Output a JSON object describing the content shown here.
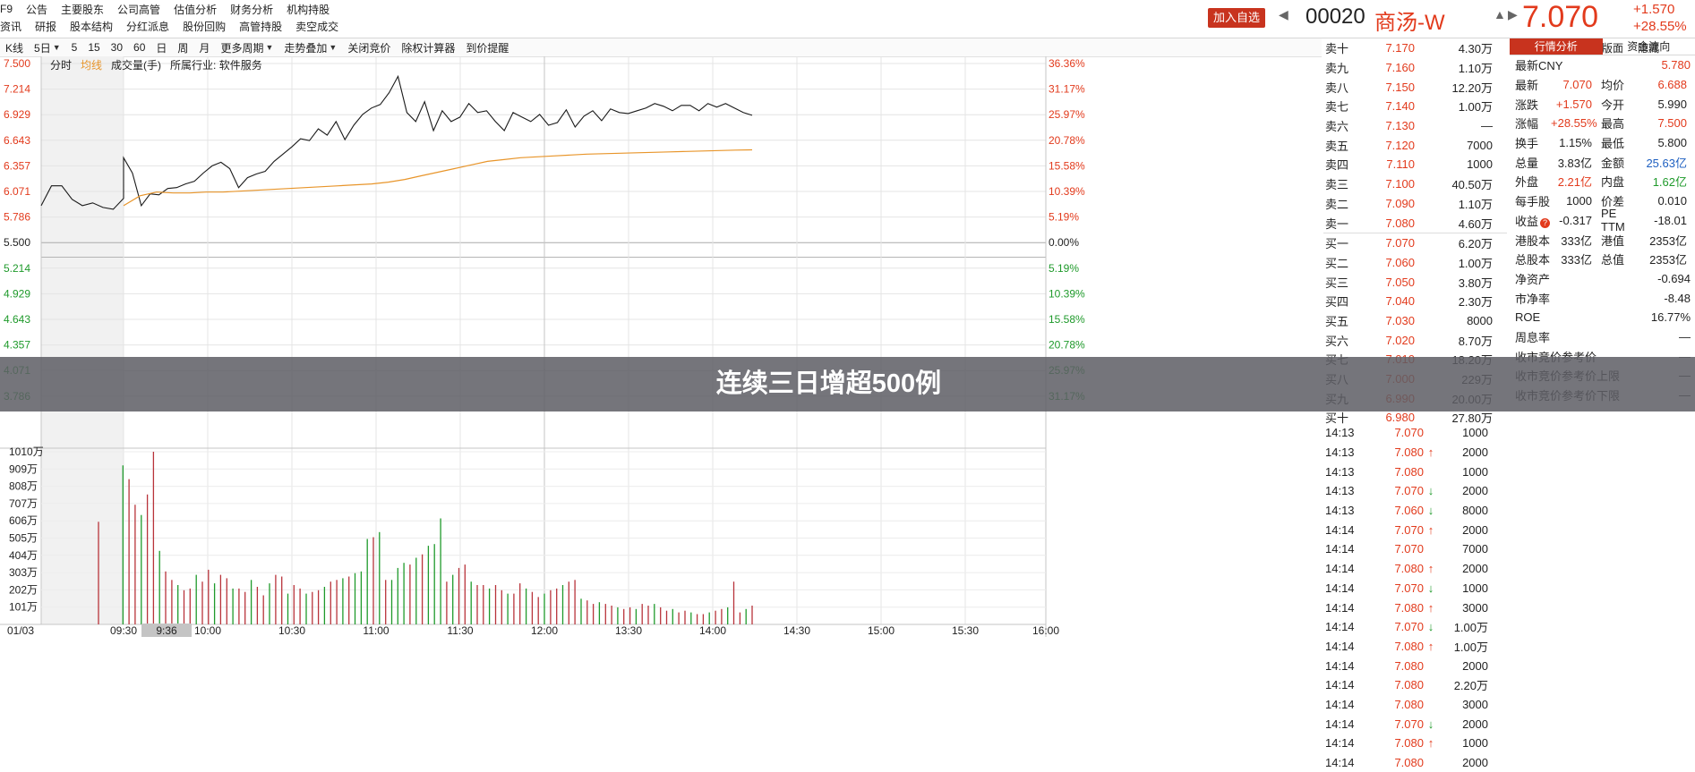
{
  "menu": {
    "row1": [
      "F9",
      "公告",
      "主要股东",
      "公司高管",
      "估值分析",
      "财务分析",
      "机构持股"
    ],
    "row2": [
      "资讯",
      "研报",
      "股本结构",
      "分红派息",
      "股份回购",
      "高管持股",
      "卖空成交"
    ]
  },
  "header": {
    "add_watch": "加入自选",
    "code": "00020",
    "name": "商汤-W",
    "price": "7.070",
    "change": "+1.570",
    "change_pct": "+28.55%"
  },
  "toolbar": {
    "items": [
      "K线",
      "5日",
      "5",
      "15",
      "30",
      "60",
      "日",
      "周",
      "月",
      "更多周期",
      "走势叠加",
      "关闭竞价",
      "除权计算器",
      "到价提醒"
    ],
    "right": [
      "简约版面",
      "隐藏"
    ]
  },
  "subbar": {
    "items": [
      "分时",
      "均线",
      "成交量(手)",
      "所属行业: 软件服务"
    ]
  },
  "chart_data": {
    "type": "line",
    "date_label": "01/03",
    "time_labels": [
      "09:30",
      "10:00",
      "10:30",
      "11:00",
      "11:30",
      "12:00",
      "13:30",
      "14:00",
      "14:30",
      "15:00",
      "15:30",
      "16:00"
    ],
    "cursor_time": "9:36",
    "price_ticks": [
      "7.500",
      "7.214",
      "6.929",
      "6.643",
      "6.357",
      "6.071",
      "5.786",
      "5.500",
      "5.214",
      "4.929",
      "4.643",
      "4.357",
      "4.071",
      "3.786"
    ],
    "pct_ticks": [
      "36.36%",
      "31.17%",
      "25.97%",
      "20.78%",
      "15.58%",
      "10.39%",
      "5.19%",
      "0.00%",
      "5.19%",
      "10.39%",
      "15.58%",
      "20.78%",
      "25.97%",
      "31.17%"
    ],
    "vol_ticks": [
      "1010万",
      "909万",
      "808万",
      "707万",
      "606万",
      "505万",
      "404万",
      "303万",
      "202万",
      "101万"
    ],
    "ylim": [
      3.643,
      7.643
    ],
    "prev_close": 5.5,
    "series": [
      {
        "values": [
          6.07,
          6.29,
          6.29,
          6.14,
          6.07,
          6.1,
          6.05,
          6.03,
          6.15,
          6.6,
          6.43,
          6.07,
          6.2,
          6.19,
          6.26,
          6.27,
          6.31,
          6.34,
          6.43,
          6.51,
          6.55,
          6.48,
          6.27,
          6.38,
          6.42,
          6.45,
          6.56,
          6.64,
          6.72,
          6.81,
          6.79,
          6.92,
          6.85,
          7.0,
          6.8,
          6.96,
          7.08,
          7.15,
          7.19,
          7.32,
          7.5,
          7.1,
          7.0,
          7.22,
          6.9,
          7.12,
          7.0,
          7.05,
          7.2,
          7.1,
          7.12,
          7.0,
          6.9,
          7.1,
          7.05,
          7.0,
          7.08,
          6.96,
          6.99,
          7.13,
          6.94,
          7.06,
          7.12,
          7.01,
          7.14,
          7.1,
          7.09,
          7.12,
          7.15,
          7.2,
          7.17,
          7.12,
          7.18,
          7.18,
          7.12,
          7.2,
          7.16,
          7.2,
          7.15,
          7.1,
          7.07
        ]
      },
      {
        "values": [
          6.07,
          6.18,
          6.22,
          6.21,
          6.21,
          6.22,
          6.22,
          6.23,
          6.24,
          6.25,
          6.26,
          6.27,
          6.28,
          6.29,
          6.3,
          6.31,
          6.33,
          6.36,
          6.4,
          6.44,
          6.48,
          6.52,
          6.56,
          6.58,
          6.6,
          6.61,
          6.62,
          6.63,
          6.64,
          6.645,
          6.65,
          6.655,
          6.66,
          6.665,
          6.67,
          6.675,
          6.68,
          6.685,
          6.688
        ]
      }
    ],
    "volumes": [
      600,
      0,
      0,
      0,
      930,
      850,
      700,
      640,
      760,
      1010,
      430,
      310,
      260,
      230,
      200,
      210,
      290,
      250,
      320,
      240,
      290,
      270,
      210,
      210,
      190,
      260,
      220,
      170,
      240,
      290,
      280,
      180,
      230,
      210,
      180,
      190,
      200,
      220,
      250,
      260,
      270,
      280,
      300,
      310,
      500,
      510,
      540,
      260,
      260,
      330,
      360,
      350,
      390,
      410,
      460,
      470,
      620,
      250,
      290,
      330,
      350,
      250,
      230,
      230,
      210,
      230,
      200,
      180,
      180,
      240,
      210,
      190,
      160,
      180,
      200,
      210,
      230,
      250,
      260,
      150,
      140,
      120,
      130,
      120,
      110,
      100,
      90,
      100,
      90,
      120,
      110,
      120,
      100,
      80,
      90,
      70,
      80,
      70,
      60,
      60,
      70,
      80,
      90,
      100,
      250,
      70,
      90,
      110
    ]
  },
  "orderbook": {
    "asks": [
      {
        "label": "卖十",
        "price": "7.170",
        "vol": "4.30万"
      },
      {
        "label": "卖九",
        "price": "7.160",
        "vol": "1.10万"
      },
      {
        "label": "卖八",
        "price": "7.150",
        "vol": "12.20万"
      },
      {
        "label": "卖七",
        "price": "7.140",
        "vol": "1.00万"
      },
      {
        "label": "卖六",
        "price": "7.130",
        "vol": "—"
      },
      {
        "label": "卖五",
        "price": "7.120",
        "vol": "7000"
      },
      {
        "label": "卖四",
        "price": "7.110",
        "vol": "1000"
      },
      {
        "label": "卖三",
        "price": "7.100",
        "vol": "40.50万"
      },
      {
        "label": "卖二",
        "price": "7.090",
        "vol": "1.10万"
      },
      {
        "label": "卖一",
        "price": "7.080",
        "vol": "4.60万"
      }
    ],
    "bids": [
      {
        "label": "买一",
        "price": "7.070",
        "vol": "6.20万"
      },
      {
        "label": "买二",
        "price": "7.060",
        "vol": "1.00万"
      },
      {
        "label": "买三",
        "price": "7.050",
        "vol": "3.80万"
      },
      {
        "label": "买四",
        "price": "7.040",
        "vol": "2.30万"
      },
      {
        "label": "买五",
        "price": "7.030",
        "vol": "8000"
      },
      {
        "label": "买六",
        "price": "7.020",
        "vol": "8.70万"
      },
      {
        "label": "买七",
        "price": "7.010",
        "vol": "18.20万"
      },
      {
        "label": "买八",
        "price": "7.000",
        "vol": "229万"
      },
      {
        "label": "买九",
        "price": "6.990",
        "vol": "20.00万"
      },
      {
        "label": "买十",
        "price": "6.980",
        "vol": "27.80万"
      }
    ]
  },
  "trades": [
    {
      "t": "14:13",
      "p": "7.070",
      "d": "",
      "v": "1000"
    },
    {
      "t": "14:13",
      "p": "7.080",
      "d": "up",
      "v": "2000"
    },
    {
      "t": "14:13",
      "p": "7.080",
      "d": "",
      "v": "1000"
    },
    {
      "t": "14:13",
      "p": "7.070",
      "d": "dn",
      "v": "2000"
    },
    {
      "t": "14:13",
      "p": "7.060",
      "d": "dn",
      "v": "8000"
    },
    {
      "t": "14:14",
      "p": "7.070",
      "d": "up",
      "v": "2000"
    },
    {
      "t": "14:14",
      "p": "7.070",
      "d": "",
      "v": "7000"
    },
    {
      "t": "14:14",
      "p": "7.080",
      "d": "up",
      "v": "2000"
    },
    {
      "t": "14:14",
      "p": "7.070",
      "d": "dn",
      "v": "1000"
    },
    {
      "t": "14:14",
      "p": "7.080",
      "d": "up",
      "v": "3000"
    },
    {
      "t": "14:14",
      "p": "7.070",
      "d": "dn",
      "v": "1.00万"
    },
    {
      "t": "14:14",
      "p": "7.080",
      "d": "up",
      "v": "1.00万"
    },
    {
      "t": "14:14",
      "p": "7.080",
      "d": "",
      "v": "2000"
    },
    {
      "t": "14:14",
      "p": "7.080",
      "d": "",
      "v": "2.20万"
    },
    {
      "t": "14:14",
      "p": "7.080",
      "d": "",
      "v": "3000"
    },
    {
      "t": "14:14",
      "p": "7.070",
      "d": "dn",
      "v": "2000"
    },
    {
      "t": "14:14",
      "p": "7.080",
      "d": "up",
      "v": "1000"
    },
    {
      "t": "14:14",
      "p": "7.080",
      "d": "",
      "v": "2000"
    }
  ],
  "info": {
    "tabs": [
      "行情分析",
      "资金流向"
    ],
    "latest_cny_label": "最新CNY",
    "latest_cny": "5.780",
    "pairs": [
      [
        "最新",
        "7.070",
        "均价",
        "6.688"
      ],
      [
        "涨跌",
        "+1.570",
        "今开",
        "5.990"
      ],
      [
        "涨幅",
        "+28.55%",
        "最高",
        "7.500"
      ],
      [
        "换手",
        "1.15%",
        "最低",
        "5.800"
      ],
      [
        "总量",
        "3.83亿",
        "金额",
        "25.63亿"
      ],
      [
        "外盘",
        "2.21亿",
        "内盘",
        "1.62亿"
      ],
      [
        "每手股",
        "1000",
        "价差",
        "0.010"
      ],
      [
        "收益",
        "-0.317",
        "PE TTM",
        "-18.01"
      ],
      [
        "港股本",
        "333亿",
        "港值",
        "2353亿"
      ],
      [
        "总股本",
        "333亿",
        "总值",
        "2353亿"
      ]
    ],
    "singles": [
      [
        "净资产",
        "-0.694"
      ],
      [
        "市净率",
        "-8.48"
      ],
      [
        "ROE",
        "16.77%"
      ],
      [
        "周息率",
        "—"
      ],
      [
        "收市竞价参考价",
        "—"
      ],
      [
        "收市竞价参考价上限",
        "—"
      ],
      [
        "收市竞价参考价下限",
        "—"
      ]
    ]
  },
  "banner": {
    "text": "连续三日增超500例"
  },
  "colors": {
    "red": "#e23a1c",
    "green": "#1f9a2b",
    "price_line": "#1a1a1a",
    "avg_line": "#e8952a"
  }
}
